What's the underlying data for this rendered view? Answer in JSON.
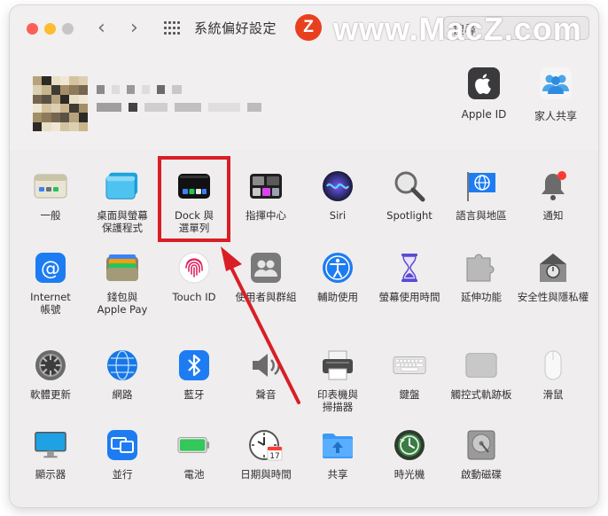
{
  "window": {
    "title": "系統偏好設定",
    "search_text": "搜尋"
  },
  "watermark": {
    "logo_letter": "Z",
    "text": "www.MacZ.com"
  },
  "account": {
    "apple_id_label": "Apple ID",
    "family_label": "家人共享"
  },
  "section1": [
    {
      "label": "一般",
      "icon": "general-icon"
    },
    {
      "label": "桌面與螢幕\n保護程式",
      "icon": "desktop-screensaver-icon"
    },
    {
      "label": "Dock 與\n選單列",
      "icon": "dock-menubar-icon"
    },
    {
      "label": "指揮中心",
      "icon": "mission-control-icon"
    },
    {
      "label": "Siri",
      "icon": "siri-icon"
    },
    {
      "label": "Spotlight",
      "icon": "spotlight-icon"
    },
    {
      "label": "語言與地區",
      "icon": "language-region-icon"
    },
    {
      "label": "通知",
      "icon": "notifications-icon"
    },
    {
      "label": "Internet\n帳號",
      "icon": "internet-accounts-icon"
    },
    {
      "label": "錢包與\nApple Pay",
      "icon": "wallet-icon"
    },
    {
      "label": "Touch ID",
      "icon": "touch-id-icon"
    },
    {
      "label": "使用者與群組",
      "icon": "users-groups-icon"
    },
    {
      "label": "輔助使用",
      "icon": "accessibility-icon"
    },
    {
      "label": "螢幕使用時間",
      "icon": "screen-time-icon"
    },
    {
      "label": "延伸功能",
      "icon": "extensions-icon"
    },
    {
      "label": "安全性與隱私權",
      "icon": "security-privacy-icon"
    }
  ],
  "section2": [
    {
      "label": "軟體更新",
      "icon": "software-update-icon"
    },
    {
      "label": "網路",
      "icon": "network-icon"
    },
    {
      "label": "藍牙",
      "icon": "bluetooth-icon"
    },
    {
      "label": "聲音",
      "icon": "sound-icon"
    },
    {
      "label": "印表機與\n掃描器",
      "icon": "printer-icon"
    },
    {
      "label": "鍵盤",
      "icon": "keyboard-icon"
    },
    {
      "label": "觸控式軌跡板",
      "icon": "trackpad-icon"
    },
    {
      "label": "滑鼠",
      "icon": "mouse-icon"
    },
    {
      "label": "顯示器",
      "icon": "displays-icon"
    },
    {
      "label": "並行",
      "icon": "sidecar-icon"
    },
    {
      "label": "電池",
      "icon": "battery-icon"
    },
    {
      "label": "日期與時間",
      "icon": "date-time-icon"
    },
    {
      "label": "共享",
      "icon": "sharing-icon"
    },
    {
      "label": "時光機",
      "icon": "time-machine-icon"
    },
    {
      "label": "啟動磁碟",
      "icon": "startup-disk-icon"
    }
  ],
  "calendar_day": "17",
  "colors": {
    "highlight": "#d91e25",
    "accent_blue": "#1d7cf2"
  }
}
